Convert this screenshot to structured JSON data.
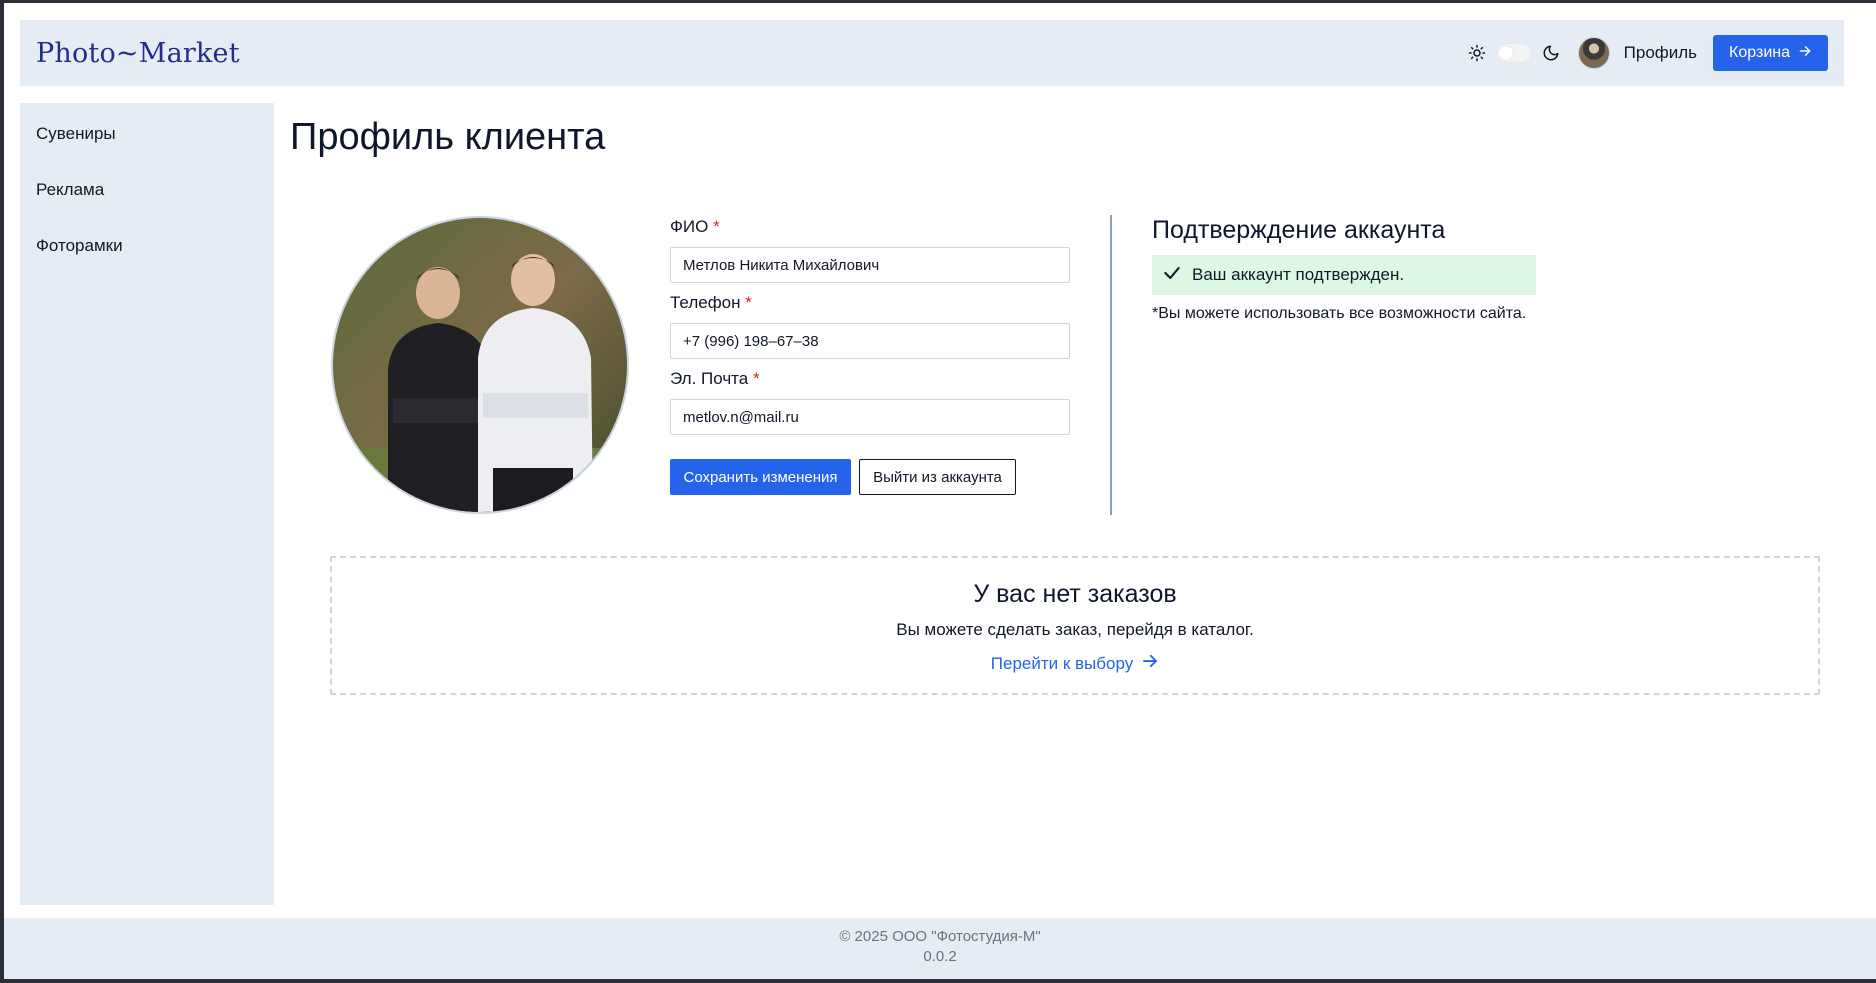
{
  "app": {
    "logo": "Photo~Market"
  },
  "header": {
    "profile_label": "Профиль",
    "cart_label": "Корзина",
    "icons": [
      "sun-icon",
      "moon-icon",
      "arrow-right-icon"
    ]
  },
  "sidebar": {
    "items": [
      {
        "label": "Сувениры"
      },
      {
        "label": "Реклама"
      },
      {
        "label": "Фоторамки"
      }
    ]
  },
  "main": {
    "title": "Профиль клиента",
    "form": {
      "name_label": "ФИО",
      "name_value": "Метлов Никита Михайлович",
      "phone_label": "Телефон",
      "phone_value": "+7 (996) 198–67–38",
      "email_label": "Эл. Почта",
      "email_value": "metlov.n@mail.ru",
      "required_mark": "*",
      "save_label": "Сохранить изменения",
      "logout_label": "Выйти из аккаунта"
    },
    "verification": {
      "title": "Подтверждение аккаунта",
      "status": "Ваш аккаунт подтвержден.",
      "note": "*Вы можете использовать все возможности сайта."
    },
    "orders": {
      "title": "У вас нет заказов",
      "subtitle": "Вы можете сделать заказ, перейдя в каталог.",
      "link_label": "Перейти к выбору"
    }
  },
  "footer": {
    "copyright": "© 2025 ООО \"Фотостудия-М\"",
    "version": "0.0.2"
  },
  "colors": {
    "accent": "#2563eb",
    "panel": "#e6ecf4",
    "success_bg": "#dcf7e3",
    "required": "#dc2626"
  }
}
